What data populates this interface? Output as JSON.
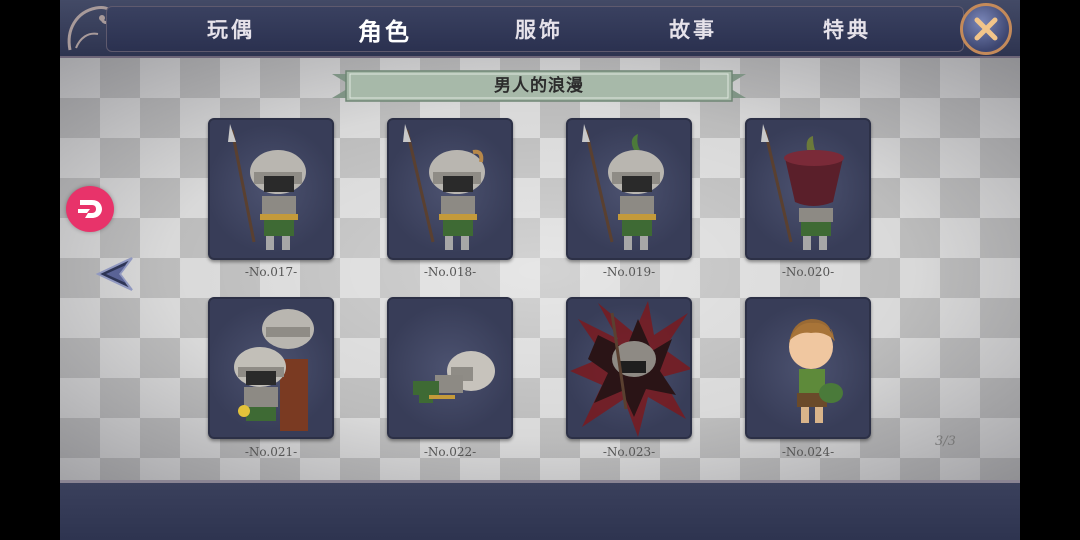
{
  "tabs": [
    {
      "label": "玩偶"
    },
    {
      "label": "角色"
    },
    {
      "label": "服饰"
    },
    {
      "label": "故事"
    },
    {
      "label": "特典"
    }
  ],
  "active_tab_index": 1,
  "ribbon": {
    "title": "男人的浪漫"
  },
  "cards": [
    {
      "label": "-No.017-",
      "icon": "spear-knight"
    },
    {
      "label": "-No.018-",
      "icon": "spear-knight-feather"
    },
    {
      "label": "-No.019-",
      "icon": "spear-knight-sprout"
    },
    {
      "label": "-No.020-",
      "icon": "spear-knight-pot-helmet"
    },
    {
      "label": "-No.021-",
      "icon": "two-knights-chair"
    },
    {
      "label": "-No.022-",
      "icon": "fallen-knight"
    },
    {
      "label": "-No.023-",
      "icon": "knight-dark-aura"
    },
    {
      "label": "-No.024-",
      "icon": "boy-with-bag"
    }
  ],
  "page_indicator": "3/3",
  "colors": {
    "accent_pink": "#e8336a",
    "frame_navy": "#2e3450",
    "ribbon_green": "#9fb3a2"
  }
}
